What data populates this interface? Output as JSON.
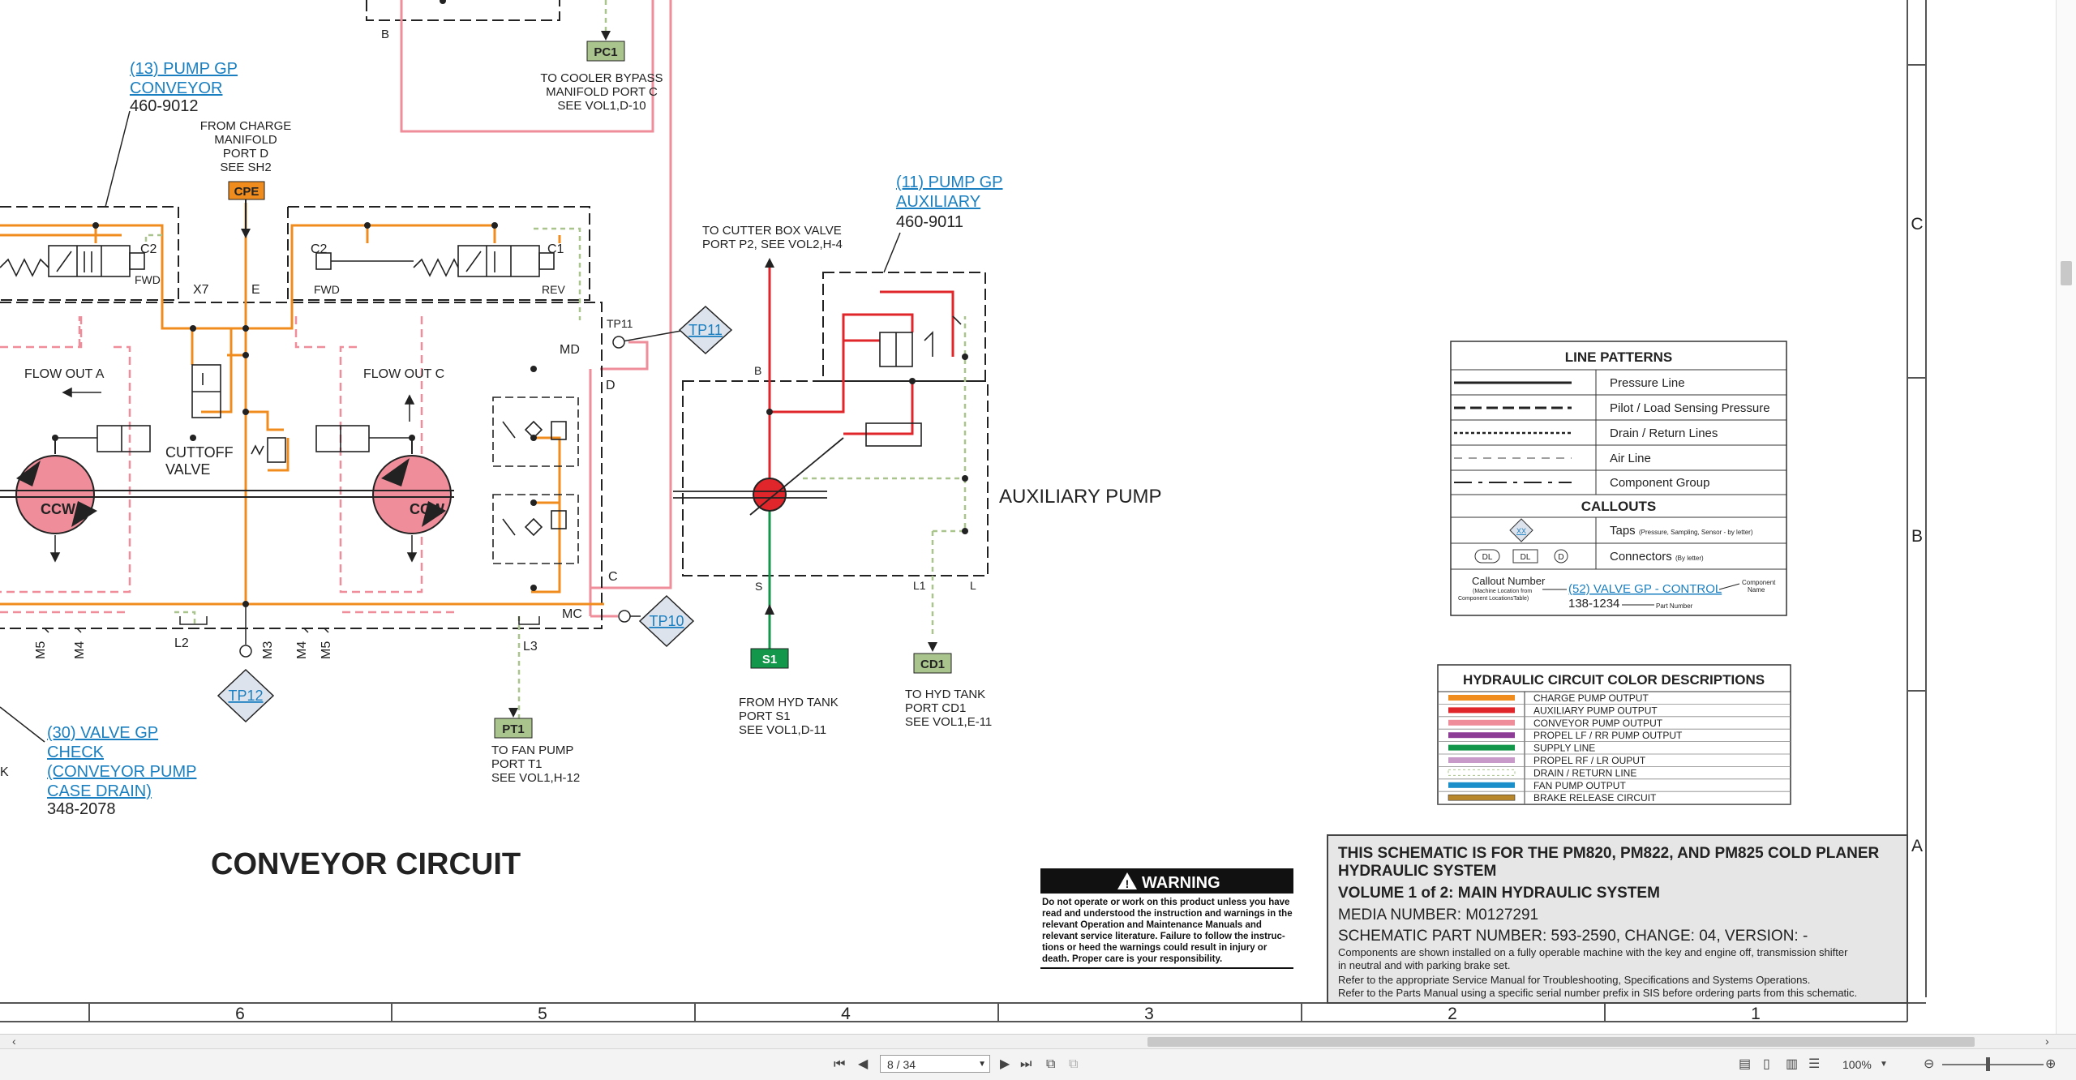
{
  "diagram": {
    "title": "CONVEYOR CIRCUIT",
    "aux_pump_label": "AUXILIARY PUMP",
    "callouts": {
      "pump13_line1": "(13) PUMP GP",
      "pump13_line2": "CONVEYOR",
      "pump13_part": "460-9012",
      "pump11_line1": "(11) PUMP GP",
      "pump11_line2": "AUXILIARY",
      "pump11_part": "460-9011",
      "valve30_line1": "(30) VALVE GP",
      "valve30_line2": "CHECK",
      "valve30_line3": "(CONVEYOR PUMP",
      "valve30_line4": "CASE DRAIN)",
      "valve30_part": "348-2078"
    },
    "notes": {
      "charge_1": "FROM CHARGE",
      "charge_2": "MANIFOLD",
      "charge_3": "PORT D",
      "charge_4": "SEE SH2",
      "cooler_1": "TO COOLER BYPASS",
      "cooler_2": "MANIFOLD PORT C",
      "cooler_3": "SEE VOL1,D-10",
      "cutter_1": "TO CUTTER BOX VALVE",
      "cutter_2": "PORT P2, SEE VOL2,H-4",
      "hydtank_s1_1": "FROM HYD TANK",
      "hydtank_s1_2": "PORT S1",
      "hydtank_s1_3": "SEE VOL1,D-11",
      "hydtank_cd1_1": "TO HYD TANK",
      "hydtank_cd1_2": "PORT CD1",
      "hydtank_cd1_3": "SEE VOL1,E-11",
      "fan_1": "TO FAN PUMP",
      "fan_2": "PORT T1",
      "fan_3": "SEE VOL1,H-12"
    },
    "connectors": {
      "pc1": "PC1",
      "cpe": "CPE",
      "s1": "S1",
      "cd1": "CD1",
      "pt1": "PT1"
    },
    "taps": {
      "tp10": "TP10",
      "tp11": "TP11",
      "tp12": "TP12",
      "tp11_small": "TP11"
    },
    "labels": {
      "b_top": "B",
      "c2_left": "C2",
      "fwd_left": "FWD",
      "x7": "X7",
      "e": "E",
      "c2_mid": "C2",
      "c1_mid": "C1",
      "fwd_mid": "FWD",
      "rev_mid": "REV",
      "flow_out_a": "FLOW OUT A",
      "flow_out_c": "FLOW OUT C",
      "cutoff_1": "CUTTOFF",
      "cutoff_2": "VALVE",
      "ccw_left": "CCW",
      "ccw_mid": "CCW",
      "md": "MD",
      "d": "D",
      "c": "C",
      "mc": "MC",
      "m5a": "M5",
      "m4a": "M4",
      "l2": "L2",
      "m3": "M3",
      "m4b": "M4",
      "m5b": "M5",
      "l3": "L3",
      "aux_b": "B",
      "aux_s": "S",
      "aux_l1": "L1",
      "aux_l": "L",
      "k": "K"
    }
  },
  "legend": {
    "line_patterns_title": "LINE PATTERNS",
    "patterns": [
      "Pressure Line",
      "Pilot / Load Sensing Pressure",
      "Drain / Return Lines",
      "Air Line",
      "Component Group"
    ],
    "callouts_title": "CALLOUTS",
    "taps_label": "Taps",
    "taps_note": "(Pressure, Sampling, Sensor - by letter)",
    "tap_symbol": "XX",
    "connectors_label": "Connectors",
    "connectors_note": "(By letter)",
    "conn_symbols": [
      "DL",
      "DL",
      "D"
    ],
    "callout_number": "Callout Number",
    "callout_number_note1": "(Machine Location from",
    "callout_number_note2": "Component LocationsTable)",
    "callout_example": "(52) VALVE GP - CONTROL",
    "component_name1": "Component",
    "component_name2": "Name",
    "part_example": "138-1234",
    "part_number": "Part Number"
  },
  "colors_table": {
    "title": "HYDRAULIC CIRCUIT COLOR DESCRIPTIONS",
    "rows": [
      {
        "label": "CHARGE PUMP OUTPUT",
        "color": "#f08c1e"
      },
      {
        "label": "AUXILIARY PUMP OUTPUT",
        "color": "#e0262a"
      },
      {
        "label": "CONVEYOR PUMP OUTPUT",
        "color": "#ef8e9a"
      },
      {
        "label": "PROPEL LF / RR PUMP OUTPUT",
        "color": "#8e3d97"
      },
      {
        "label": "SUPPLY LINE",
        "color": "#13974a"
      },
      {
        "label": "PROPEL RF / LR OUPUT",
        "color": "#c79ac9"
      },
      {
        "label": "DRAIN / RETURN LINE",
        "color": "#a9c48c"
      },
      {
        "label": "FAN PUMP OUTPUT",
        "color": "#1b8fc9"
      },
      {
        "label": "BRAKE RELEASE CIRCUIT",
        "color": "#b8862b"
      }
    ]
  },
  "warning": {
    "title": "WARNING",
    "lines": [
      "Do not operate or work on this product unless you have",
      "read and understood the instruction and warnings in the",
      "relevant Operation and Maintenance Manuals and",
      "relevant service literature. Failure to follow the instruc-",
      "tions or heed the warnings could result in injury or",
      "death. Proper care is your responsibility."
    ]
  },
  "title_block": {
    "line1": "THIS SCHEMATIC IS FOR THE PM820, PM822, AND PM825 COLD PLANER",
    "line2": "HYDRAULIC SYSTEM",
    "line3": "VOLUME 1 of 2: MAIN HYDRAULIC SYSTEM",
    "media": "MEDIA NUMBER: M0127291",
    "schematic": "SCHEMATIC PART NUMBER: 593-2590, CHANGE: 04, VERSION: -",
    "note1": "Components are shown installed on a fully operable machine with the key and engine off, transmission shifter",
    "note2": "in neutral and with parking brake set.",
    "note3": "Refer to the appropriate Service Manual for Troubleshooting, Specifications and Systems Operations.",
    "note4": "Refer to the Parts Manual using a specific serial number prefix in SIS before ordering parts from this schematic."
  },
  "grid": {
    "columns": [
      "6",
      "5",
      "4",
      "3",
      "2",
      "1"
    ],
    "rows": [
      "C",
      "B",
      "A"
    ]
  },
  "viewer": {
    "page_indicator": "8 / 34",
    "zoom": "100%",
    "icons": [
      "first-page-icon",
      "prev-page-icon",
      "next-page-icon",
      "last-page-icon",
      "zoom-out-icon",
      "zoom-in-icon"
    ]
  }
}
